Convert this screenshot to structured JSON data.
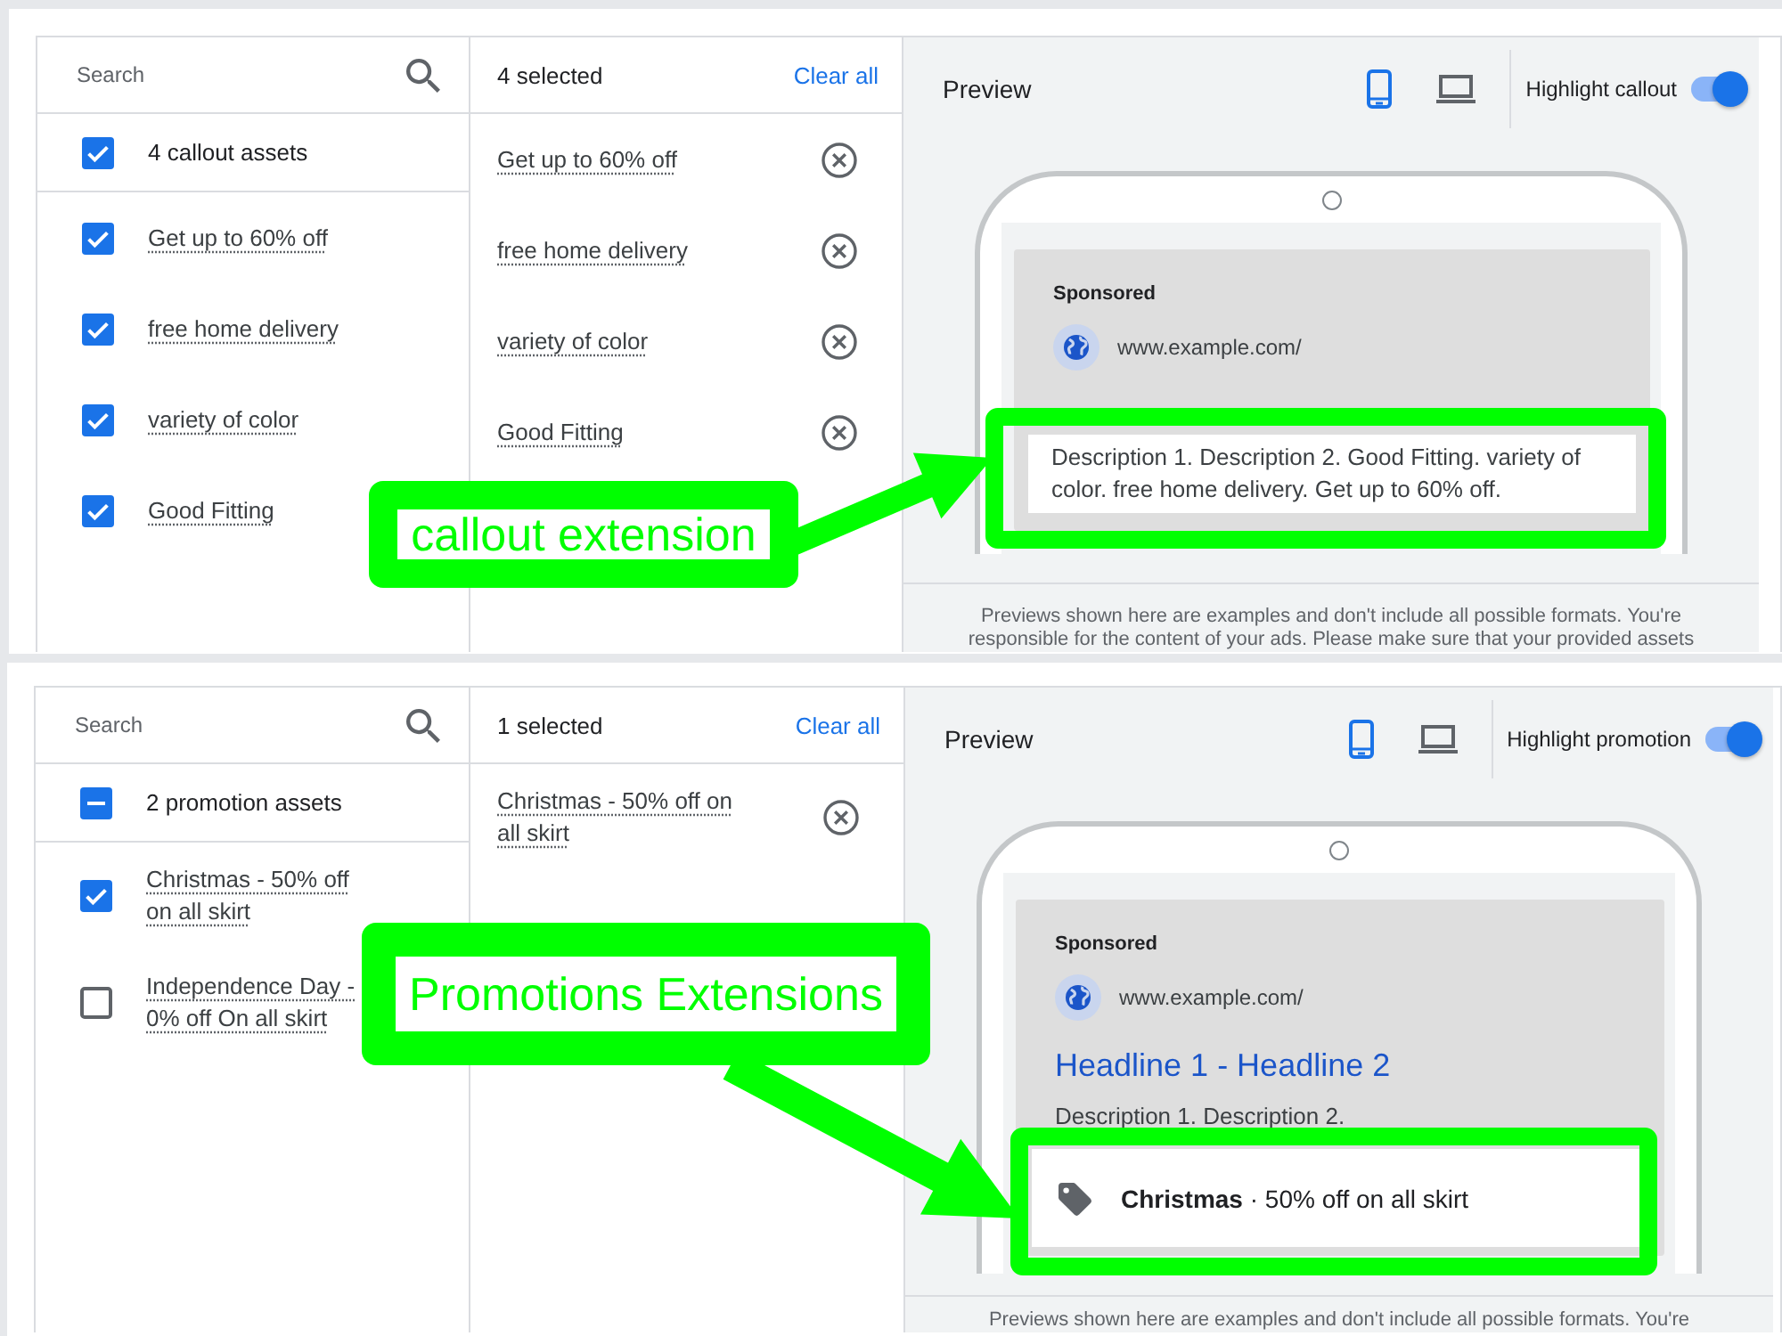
{
  "screens": [
    {
      "search": {
        "placeholder": "Search"
      },
      "group": {
        "label": "4 callout assets",
        "checked": true,
        "indeterminate": false
      },
      "assets": [
        {
          "label": "Get up to 60% off",
          "checked": true
        },
        {
          "label": "free home delivery",
          "checked": true
        },
        {
          "label": "variety of color",
          "checked": true
        },
        {
          "label": "Good Fitting",
          "checked": true
        }
      ],
      "selection": {
        "count": "4 selected",
        "clear": "Clear all",
        "items": [
          "Get up to 60% off",
          "free home delivery",
          "variety of color",
          "Good Fitting"
        ]
      },
      "preview": {
        "title": "Preview",
        "devices": [
          {
            "kind": "mobile",
            "selected": true
          },
          {
            "kind": "desktop",
            "selected": false
          }
        ],
        "highlight": {
          "label": "Highlight callout",
          "on": true
        },
        "ad": {
          "sponsored": "Sponsored",
          "url": "www.example.com/",
          "lines": [
            {
              "kind": "callout",
              "text": "Description 1. Description 2. Good Fitting. variety of color. free home delivery. Get up to 60% off."
            }
          ]
        },
        "footer": "Previews shown here are examples and don't include all possible formats. You're responsible for the content of your ads. Please make sure that your provided assets"
      },
      "annotation": {
        "label": "callout extension"
      }
    },
    {
      "search": {
        "placeholder": "Search"
      },
      "group": {
        "label": "2 promotion assets",
        "checked": false,
        "indeterminate": true
      },
      "assets": [
        {
          "label": "Christmas - 50% off on all skirt",
          "checked": true
        },
        {
          "label": "Independence Day - 0% off On all skirt",
          "checked": false
        }
      ],
      "selection": {
        "count": "1 selected",
        "clear": "Clear all",
        "items": [
          "Christmas - 50% off on all skirt"
        ]
      },
      "preview": {
        "title": "Preview",
        "devices": [
          {
            "kind": "mobile",
            "selected": true
          },
          {
            "kind": "desktop",
            "selected": false
          }
        ],
        "highlight": {
          "label": "Highlight promotion",
          "on": true
        },
        "ad": {
          "sponsored": "Sponsored",
          "url": "www.example.com/",
          "lines": [
            {
              "kind": "headline",
              "text": "Headline 1 - Headline 2"
            },
            {
              "kind": "description",
              "text": "Description 1. Description 2."
            },
            {
              "kind": "promotion",
              "text": "**Christmas** · 50% off on all skirt"
            }
          ]
        },
        "footer": "Previews shown here are examples and don't include all possible formats. You're"
      },
      "annotation": {
        "label": "Promotions Extensions"
      }
    }
  ]
}
